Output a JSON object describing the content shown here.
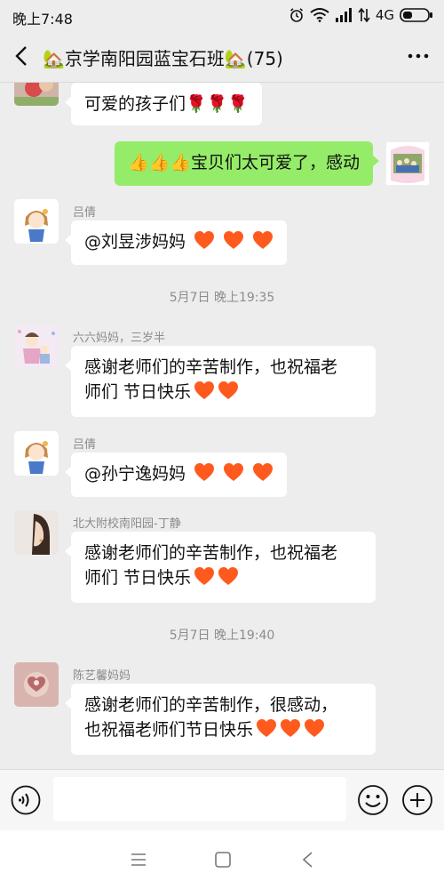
{
  "status": {
    "time": "晚上7:48",
    "network": "4G"
  },
  "nav": {
    "title": "🏡京学南阳园蓝宝石班🏡(75)"
  },
  "messages": [
    {
      "text": "可爱的孩子们🌹🌹🌹"
    },
    {
      "text": "👍👍👍宝贝们太可爱了，感动"
    },
    {
      "name": "吕倩",
      "text": "@刘昱涉妈妈"
    },
    {
      "name": "六六妈妈，三岁半",
      "line1": "感谢老师们的辛苦制作，也祝福老",
      "line2": "师们 节日快乐"
    },
    {
      "name": "吕倩",
      "text": "@孙宁逸妈妈"
    },
    {
      "name": "北大附校南阳园-丁静",
      "line1": "感谢老师们的辛苦制作，也祝福老",
      "line2": "师们 节日快乐"
    },
    {
      "name": "陈艺馨妈妈",
      "line1": "感谢老师们的辛苦制作，很感动，",
      "line2": "也祝福老师们节日快乐"
    }
  ],
  "timestamps": [
    "5月7日 晚上19:35",
    "5月7日 晚上19:40"
  ],
  "input": {
    "value": ""
  },
  "colors": {
    "accent_bubble": "#95ec69",
    "background": "#ededed",
    "heart": "#ff5a1e"
  }
}
